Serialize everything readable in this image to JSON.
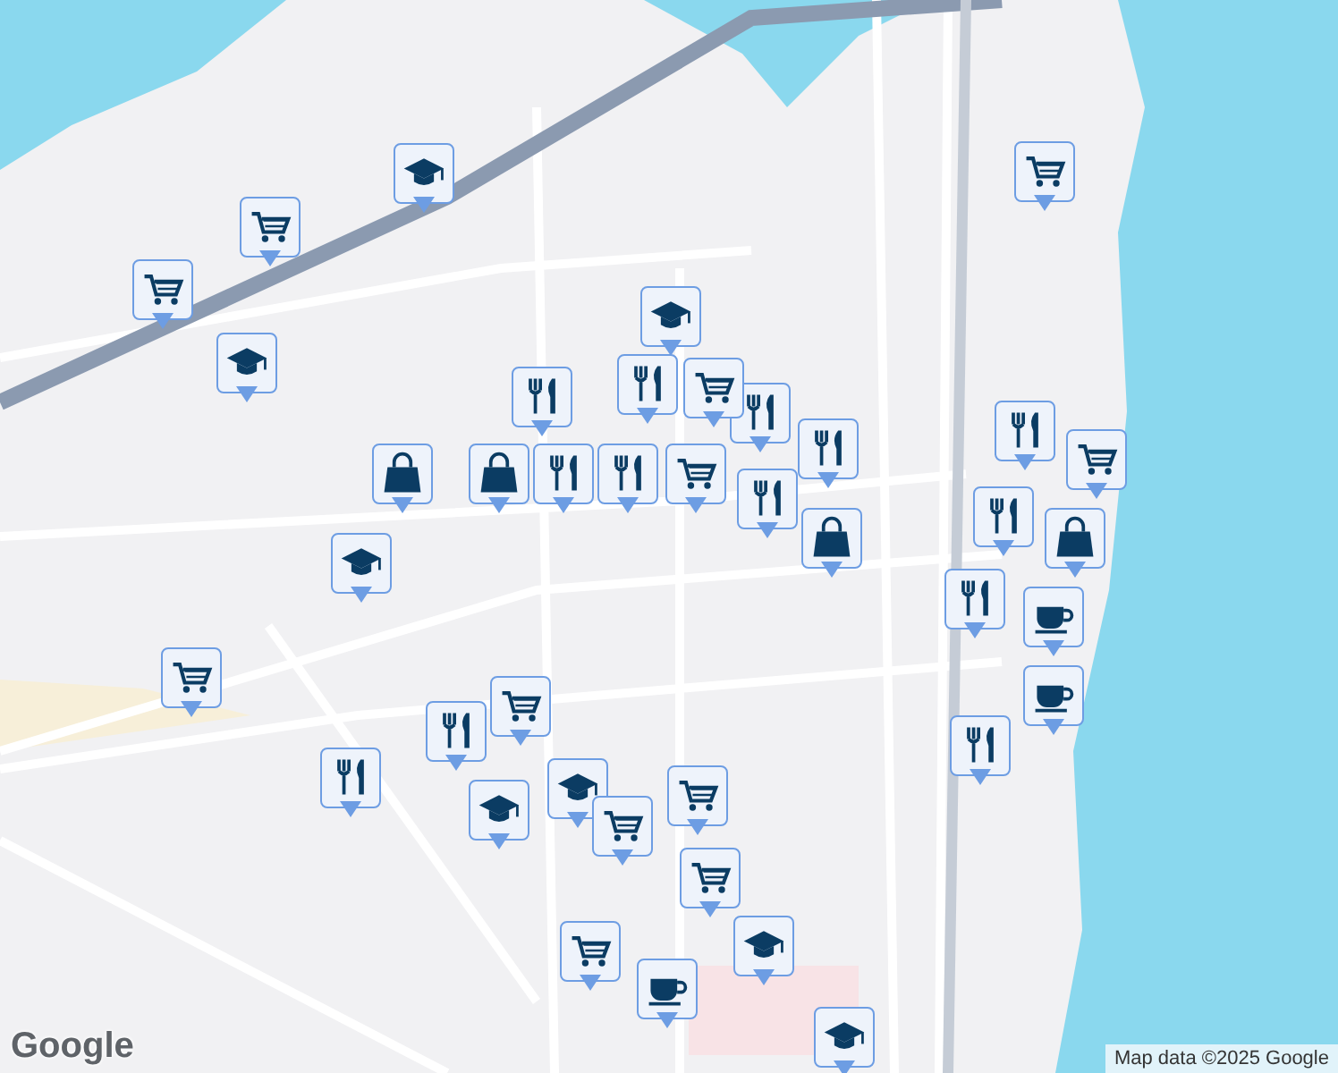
{
  "map": {
    "markers": [
      {
        "kind": "school"
      },
      {
        "kind": "cart"
      },
      {
        "kind": "cart"
      },
      {
        "kind": "school"
      },
      {
        "kind": "school"
      },
      {
        "kind": "cart"
      },
      {
        "kind": "food"
      },
      {
        "kind": "bag"
      },
      {
        "kind": "food"
      },
      {
        "kind": "food"
      },
      {
        "kind": "food"
      },
      {
        "kind": "cart"
      },
      {
        "kind": "food"
      },
      {
        "kind": "cart"
      },
      {
        "kind": "food"
      },
      {
        "kind": "food"
      },
      {
        "kind": "bag"
      },
      {
        "kind": "bag"
      },
      {
        "kind": "school"
      },
      {
        "kind": "cart"
      },
      {
        "kind": "food"
      },
      {
        "kind": "cart"
      },
      {
        "kind": "food"
      },
      {
        "kind": "bag"
      },
      {
        "kind": "food"
      },
      {
        "kind": "coffee"
      },
      {
        "kind": "coffee"
      },
      {
        "kind": "food"
      },
      {
        "kind": "food"
      },
      {
        "kind": "cart"
      },
      {
        "kind": "school"
      },
      {
        "kind": "school"
      },
      {
        "kind": "food"
      },
      {
        "kind": "cart"
      },
      {
        "kind": "cart"
      },
      {
        "kind": "cart"
      },
      {
        "kind": "cart"
      },
      {
        "kind": "coffee"
      },
      {
        "kind": "school"
      },
      {
        "kind": "school"
      }
    ]
  },
  "logo": "Google",
  "attribution": "Map data ©2025 Google"
}
